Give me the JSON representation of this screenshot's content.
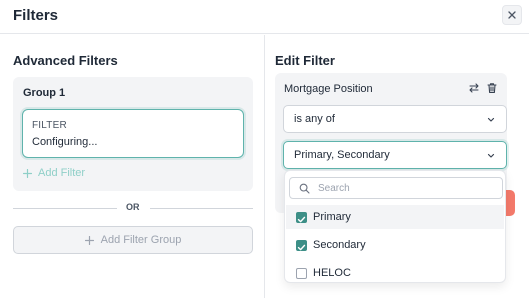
{
  "header": {
    "title": "Filters",
    "close_icon": "close-icon"
  },
  "left": {
    "section_title": "Advanced Filters",
    "group": {
      "title": "Group 1",
      "filter": {
        "label": "FILTER",
        "value": "Configuring..."
      },
      "add_filter_label": "Add Filter"
    },
    "or_label": "OR",
    "add_group_label": "Add Filter Group"
  },
  "right": {
    "section_title": "Edit Filter",
    "field_name": "Mortgage Position",
    "operator": "is any of",
    "selected_values": "Primary, Secondary",
    "dropdown": {
      "search_placeholder": "Search",
      "options": [
        {
          "label": "Primary",
          "checked": true
        },
        {
          "label": "Secondary",
          "checked": true
        },
        {
          "label": "HELOC",
          "checked": false
        }
      ]
    }
  },
  "colors": {
    "accent": "#3d8f87",
    "accent_light": "#8fcfc8",
    "focus_border": "#5fb3ac",
    "danger": "#f47a6b"
  }
}
